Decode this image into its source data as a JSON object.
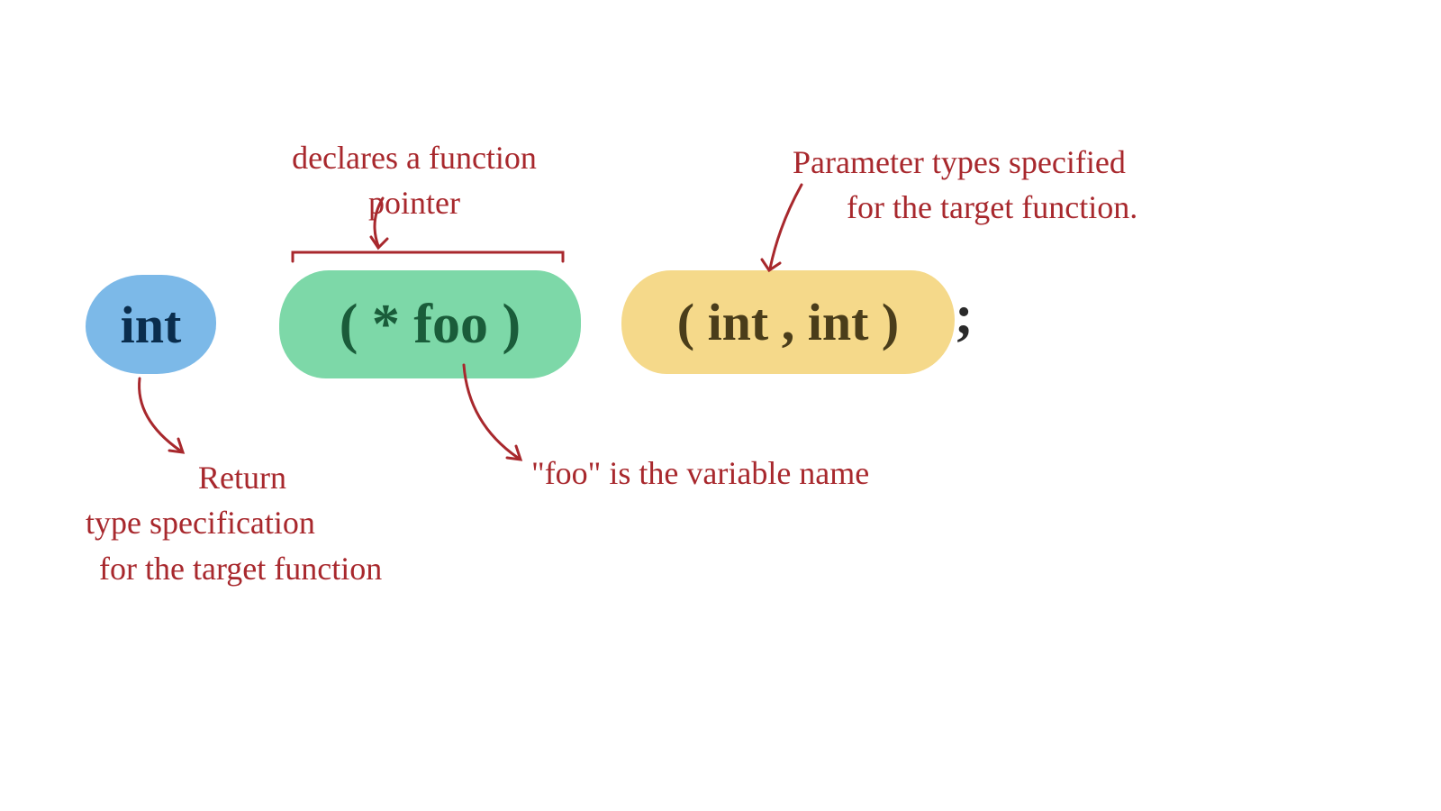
{
  "code": {
    "return_type": "int",
    "pointer_decl": "( * foo )",
    "params": "( int , int )",
    "terminator": ";"
  },
  "annotations": {
    "top_left": "declares a function pointer",
    "top_right_line1": "Parameter types specified",
    "top_right_line2": "for the target function.",
    "bottom_left_line1": "Return",
    "bottom_left_line2": "type specification",
    "bottom_left_line3": "for the target function",
    "bottom_right": "\"foo\" is the variable name"
  },
  "colors": {
    "annotation": "#a8282d",
    "blue_bg": "#7cb9e8",
    "green_bg": "#7dd8a8",
    "yellow_bg": "#f5d98a"
  }
}
